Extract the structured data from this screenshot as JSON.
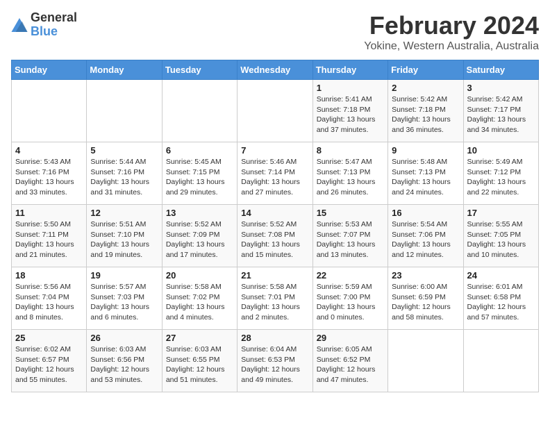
{
  "header": {
    "logo_general": "General",
    "logo_blue": "Blue",
    "title": "February 2024",
    "subtitle": "Yokine, Western Australia, Australia"
  },
  "calendar": {
    "weekdays": [
      "Sunday",
      "Monday",
      "Tuesday",
      "Wednesday",
      "Thursday",
      "Friday",
      "Saturday"
    ],
    "weeks": [
      [
        {
          "day": "",
          "info": ""
        },
        {
          "day": "",
          "info": ""
        },
        {
          "day": "",
          "info": ""
        },
        {
          "day": "",
          "info": ""
        },
        {
          "day": "1",
          "info": "Sunrise: 5:41 AM\nSunset: 7:18 PM\nDaylight: 13 hours\nand 37 minutes."
        },
        {
          "day": "2",
          "info": "Sunrise: 5:42 AM\nSunset: 7:18 PM\nDaylight: 13 hours\nand 36 minutes."
        },
        {
          "day": "3",
          "info": "Sunrise: 5:42 AM\nSunset: 7:17 PM\nDaylight: 13 hours\nand 34 minutes."
        }
      ],
      [
        {
          "day": "4",
          "info": "Sunrise: 5:43 AM\nSunset: 7:16 PM\nDaylight: 13 hours\nand 33 minutes."
        },
        {
          "day": "5",
          "info": "Sunrise: 5:44 AM\nSunset: 7:16 PM\nDaylight: 13 hours\nand 31 minutes."
        },
        {
          "day": "6",
          "info": "Sunrise: 5:45 AM\nSunset: 7:15 PM\nDaylight: 13 hours\nand 29 minutes."
        },
        {
          "day": "7",
          "info": "Sunrise: 5:46 AM\nSunset: 7:14 PM\nDaylight: 13 hours\nand 27 minutes."
        },
        {
          "day": "8",
          "info": "Sunrise: 5:47 AM\nSunset: 7:13 PM\nDaylight: 13 hours\nand 26 minutes."
        },
        {
          "day": "9",
          "info": "Sunrise: 5:48 AM\nSunset: 7:13 PM\nDaylight: 13 hours\nand 24 minutes."
        },
        {
          "day": "10",
          "info": "Sunrise: 5:49 AM\nSunset: 7:12 PM\nDaylight: 13 hours\nand 22 minutes."
        }
      ],
      [
        {
          "day": "11",
          "info": "Sunrise: 5:50 AM\nSunset: 7:11 PM\nDaylight: 13 hours\nand 21 minutes."
        },
        {
          "day": "12",
          "info": "Sunrise: 5:51 AM\nSunset: 7:10 PM\nDaylight: 13 hours\nand 19 minutes."
        },
        {
          "day": "13",
          "info": "Sunrise: 5:52 AM\nSunset: 7:09 PM\nDaylight: 13 hours\nand 17 minutes."
        },
        {
          "day": "14",
          "info": "Sunrise: 5:52 AM\nSunset: 7:08 PM\nDaylight: 13 hours\nand 15 minutes."
        },
        {
          "day": "15",
          "info": "Sunrise: 5:53 AM\nSunset: 7:07 PM\nDaylight: 13 hours\nand 13 minutes."
        },
        {
          "day": "16",
          "info": "Sunrise: 5:54 AM\nSunset: 7:06 PM\nDaylight: 13 hours\nand 12 minutes."
        },
        {
          "day": "17",
          "info": "Sunrise: 5:55 AM\nSunset: 7:05 PM\nDaylight: 13 hours\nand 10 minutes."
        }
      ],
      [
        {
          "day": "18",
          "info": "Sunrise: 5:56 AM\nSunset: 7:04 PM\nDaylight: 13 hours\nand 8 minutes."
        },
        {
          "day": "19",
          "info": "Sunrise: 5:57 AM\nSunset: 7:03 PM\nDaylight: 13 hours\nand 6 minutes."
        },
        {
          "day": "20",
          "info": "Sunrise: 5:58 AM\nSunset: 7:02 PM\nDaylight: 13 hours\nand 4 minutes."
        },
        {
          "day": "21",
          "info": "Sunrise: 5:58 AM\nSunset: 7:01 PM\nDaylight: 13 hours\nand 2 minutes."
        },
        {
          "day": "22",
          "info": "Sunrise: 5:59 AM\nSunset: 7:00 PM\nDaylight: 13 hours\nand 0 minutes."
        },
        {
          "day": "23",
          "info": "Sunrise: 6:00 AM\nSunset: 6:59 PM\nDaylight: 12 hours\nand 58 minutes."
        },
        {
          "day": "24",
          "info": "Sunrise: 6:01 AM\nSunset: 6:58 PM\nDaylight: 12 hours\nand 57 minutes."
        }
      ],
      [
        {
          "day": "25",
          "info": "Sunrise: 6:02 AM\nSunset: 6:57 PM\nDaylight: 12 hours\nand 55 minutes."
        },
        {
          "day": "26",
          "info": "Sunrise: 6:03 AM\nSunset: 6:56 PM\nDaylight: 12 hours\nand 53 minutes."
        },
        {
          "day": "27",
          "info": "Sunrise: 6:03 AM\nSunset: 6:55 PM\nDaylight: 12 hours\nand 51 minutes."
        },
        {
          "day": "28",
          "info": "Sunrise: 6:04 AM\nSunset: 6:53 PM\nDaylight: 12 hours\nand 49 minutes."
        },
        {
          "day": "29",
          "info": "Sunrise: 6:05 AM\nSunset: 6:52 PM\nDaylight: 12 hours\nand 47 minutes."
        },
        {
          "day": "",
          "info": ""
        },
        {
          "day": "",
          "info": ""
        }
      ]
    ]
  }
}
